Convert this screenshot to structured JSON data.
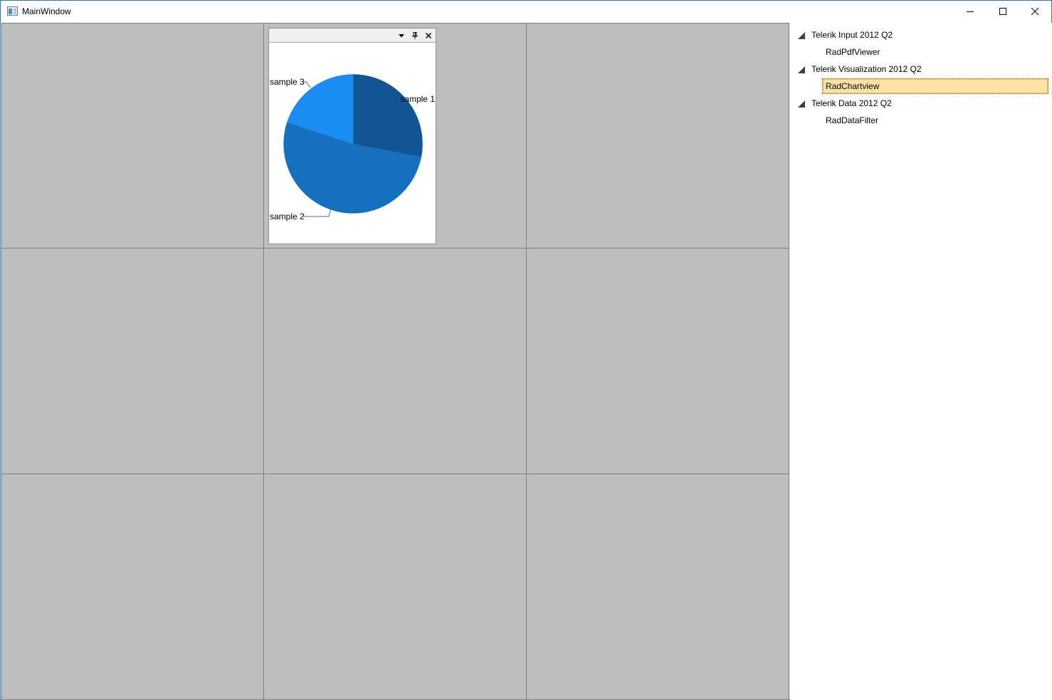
{
  "window": {
    "title": "MainWindow"
  },
  "caption": {
    "minimize_icon": "minimize-icon",
    "maximize_icon": "maximize-icon",
    "close_icon": "close-icon"
  },
  "panel": {
    "menu_icon": "dropdown-arrow-icon",
    "pin_icon": "pin-icon",
    "close_icon": "close-icon"
  },
  "chart_data": {
    "type": "pie",
    "categories": [
      "sample 1",
      "sample 2",
      "sample 3"
    ],
    "values": [
      28,
      52,
      20
    ],
    "colors": [
      "#115592",
      "#1670c0",
      "#1b8cf2"
    ],
    "start_angle_deg": -90
  },
  "tree": {
    "groups": [
      {
        "label": "Telerik Input 2012 Q2",
        "children": [
          "RadPdfViewer"
        ]
      },
      {
        "label": "Telerik Visualization 2012 Q2",
        "children": [
          "RadChartview"
        ]
      },
      {
        "label": "Telerik Data 2012 Q2",
        "children": [
          "RadDataFilter"
        ]
      }
    ],
    "selected": "RadChartview"
  },
  "colors": {
    "grid_background": "#bebebe",
    "grid_border": "#7f7f7f",
    "selection_background": "#ffe3a6",
    "window_border": "#2b79c2"
  }
}
